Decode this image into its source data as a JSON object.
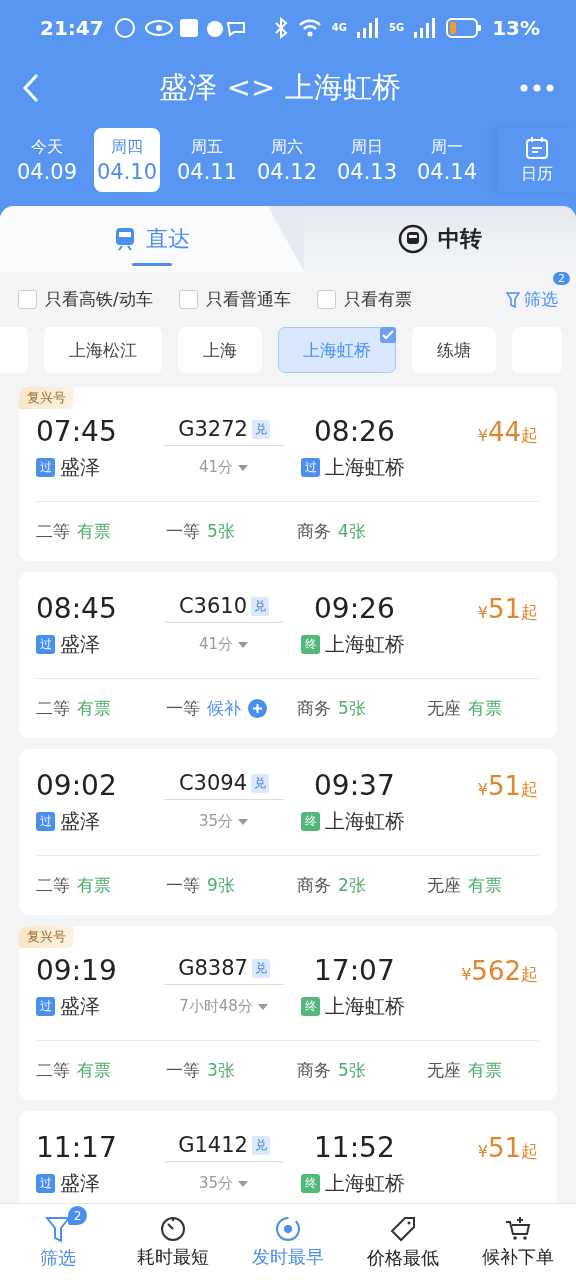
{
  "status_bar": {
    "time": "21:47",
    "network_labels": [
      "4G",
      "5G"
    ],
    "battery_text": "13%"
  },
  "header": {
    "title": "盛泽 <> 上海虹桥"
  },
  "dates": [
    {
      "weekday": "今天",
      "date": "04.09",
      "selected": false
    },
    {
      "weekday": "周四",
      "date": "04.10",
      "selected": true
    },
    {
      "weekday": "周五",
      "date": "04.11",
      "selected": false
    },
    {
      "weekday": "周六",
      "date": "04.12",
      "selected": false
    },
    {
      "weekday": "周日",
      "date": "04.13",
      "selected": false
    },
    {
      "weekday": "周一",
      "date": "04.14",
      "selected": false
    }
  ],
  "calendar_label": "日历",
  "mode_tabs": [
    {
      "label": "直达",
      "kind": "direct",
      "selected": true
    },
    {
      "label": "中转",
      "kind": "transfer",
      "selected": false
    }
  ],
  "filters": [
    {
      "label": "只看高铁/动车",
      "checked": false
    },
    {
      "label": "只看普通车",
      "checked": false
    },
    {
      "label": "只看有票",
      "checked": false
    }
  ],
  "filter_button": {
    "label": "筛选",
    "badge": "2"
  },
  "stations": [
    {
      "selected": false
    },
    {
      "label": "上海松江",
      "selected": false
    },
    {
      "label": "上海",
      "selected": false
    },
    {
      "label": "上海虹桥",
      "selected": true
    },
    {
      "label": "练塘",
      "selected": false
    },
    {
      "selected": false
    }
  ],
  "trains": [
    {
      "tag": "复兴号",
      "depart": "07:45",
      "train_no": "G3272",
      "exchange": "兑",
      "duration": "41分",
      "arrive": "08:26",
      "from": {
        "badge": "过",
        "kind": "pass",
        "name": "盛泽"
      },
      "to": {
        "badge": "过",
        "kind": "pass",
        "name": "上海虹桥"
      },
      "price_symbol": "¥",
      "price": "44",
      "price_suffix": "起",
      "seats": [
        {
          "class": "二等",
          "status": "有票",
          "kind": "available"
        },
        {
          "class": "一等",
          "status": "5张",
          "kind": "available"
        },
        {
          "class": "商务",
          "status": "4张",
          "kind": "available"
        }
      ]
    },
    {
      "depart": "08:45",
      "train_no": "C3610",
      "exchange": "兑",
      "duration": "41分",
      "arrive": "09:26",
      "from": {
        "badge": "过",
        "kind": "pass",
        "name": "盛泽"
      },
      "to": {
        "badge": "终",
        "kind": "terminal",
        "name": "上海虹桥"
      },
      "price_symbol": "¥",
      "price": "51",
      "price_suffix": "起",
      "seats": [
        {
          "class": "二等",
          "status": "有票",
          "kind": "available"
        },
        {
          "class": "一等",
          "status": "候补",
          "kind": "waitlist"
        },
        {
          "class": "商务",
          "status": "5张",
          "kind": "available"
        },
        {
          "class": "无座",
          "status": "有票",
          "kind": "available"
        }
      ]
    },
    {
      "depart": "09:02",
      "train_no": "C3094",
      "exchange": "兑",
      "duration": "35分",
      "arrive": "09:37",
      "from": {
        "badge": "过",
        "kind": "pass",
        "name": "盛泽"
      },
      "to": {
        "badge": "终",
        "kind": "terminal",
        "name": "上海虹桥"
      },
      "price_symbol": "¥",
      "price": "51",
      "price_suffix": "起",
      "seats": [
        {
          "class": "二等",
          "status": "有票",
          "kind": "available"
        },
        {
          "class": "一等",
          "status": "9张",
          "kind": "available"
        },
        {
          "class": "商务",
          "status": "2张",
          "kind": "available"
        },
        {
          "class": "无座",
          "status": "有票",
          "kind": "available"
        }
      ]
    },
    {
      "tag": "复兴号",
      "depart": "09:19",
      "train_no": "G8387",
      "exchange": "兑",
      "duration": "7小时48分",
      "arrive": "17:07",
      "from": {
        "badge": "过",
        "kind": "pass",
        "name": "盛泽"
      },
      "to": {
        "badge": "终",
        "kind": "terminal",
        "name": "上海虹桥"
      },
      "price_symbol": "¥",
      "price": "562",
      "price_suffix": "起",
      "seats": [
        {
          "class": "二等",
          "status": "有票",
          "kind": "available"
        },
        {
          "class": "一等",
          "status": "3张",
          "kind": "available"
        },
        {
          "class": "商务",
          "status": "5张",
          "kind": "available"
        },
        {
          "class": "无座",
          "status": "有票",
          "kind": "available"
        }
      ]
    },
    {
      "depart": "11:17",
      "train_no": "G1412",
      "exchange": "兑",
      "duration": "35分",
      "arrive": "11:52",
      "from": {
        "badge": "过",
        "kind": "pass",
        "name": "盛泽"
      },
      "to": {
        "badge": "终",
        "kind": "terminal",
        "name": "上海虹桥"
      },
      "price_symbol": "¥",
      "price": "51",
      "price_suffix": "起"
    }
  ],
  "bottom_bar": [
    {
      "label": "筛选",
      "kind": "filter",
      "badge": "2",
      "selected": true
    },
    {
      "label": "耗时最短",
      "kind": "timer",
      "selected": false
    },
    {
      "label": "发时最早",
      "kind": "clock24",
      "selected": true
    },
    {
      "label": "价格最低",
      "kind": "tag",
      "selected": false
    },
    {
      "label": "候补下单",
      "kind": "cart",
      "selected": false
    }
  ]
}
